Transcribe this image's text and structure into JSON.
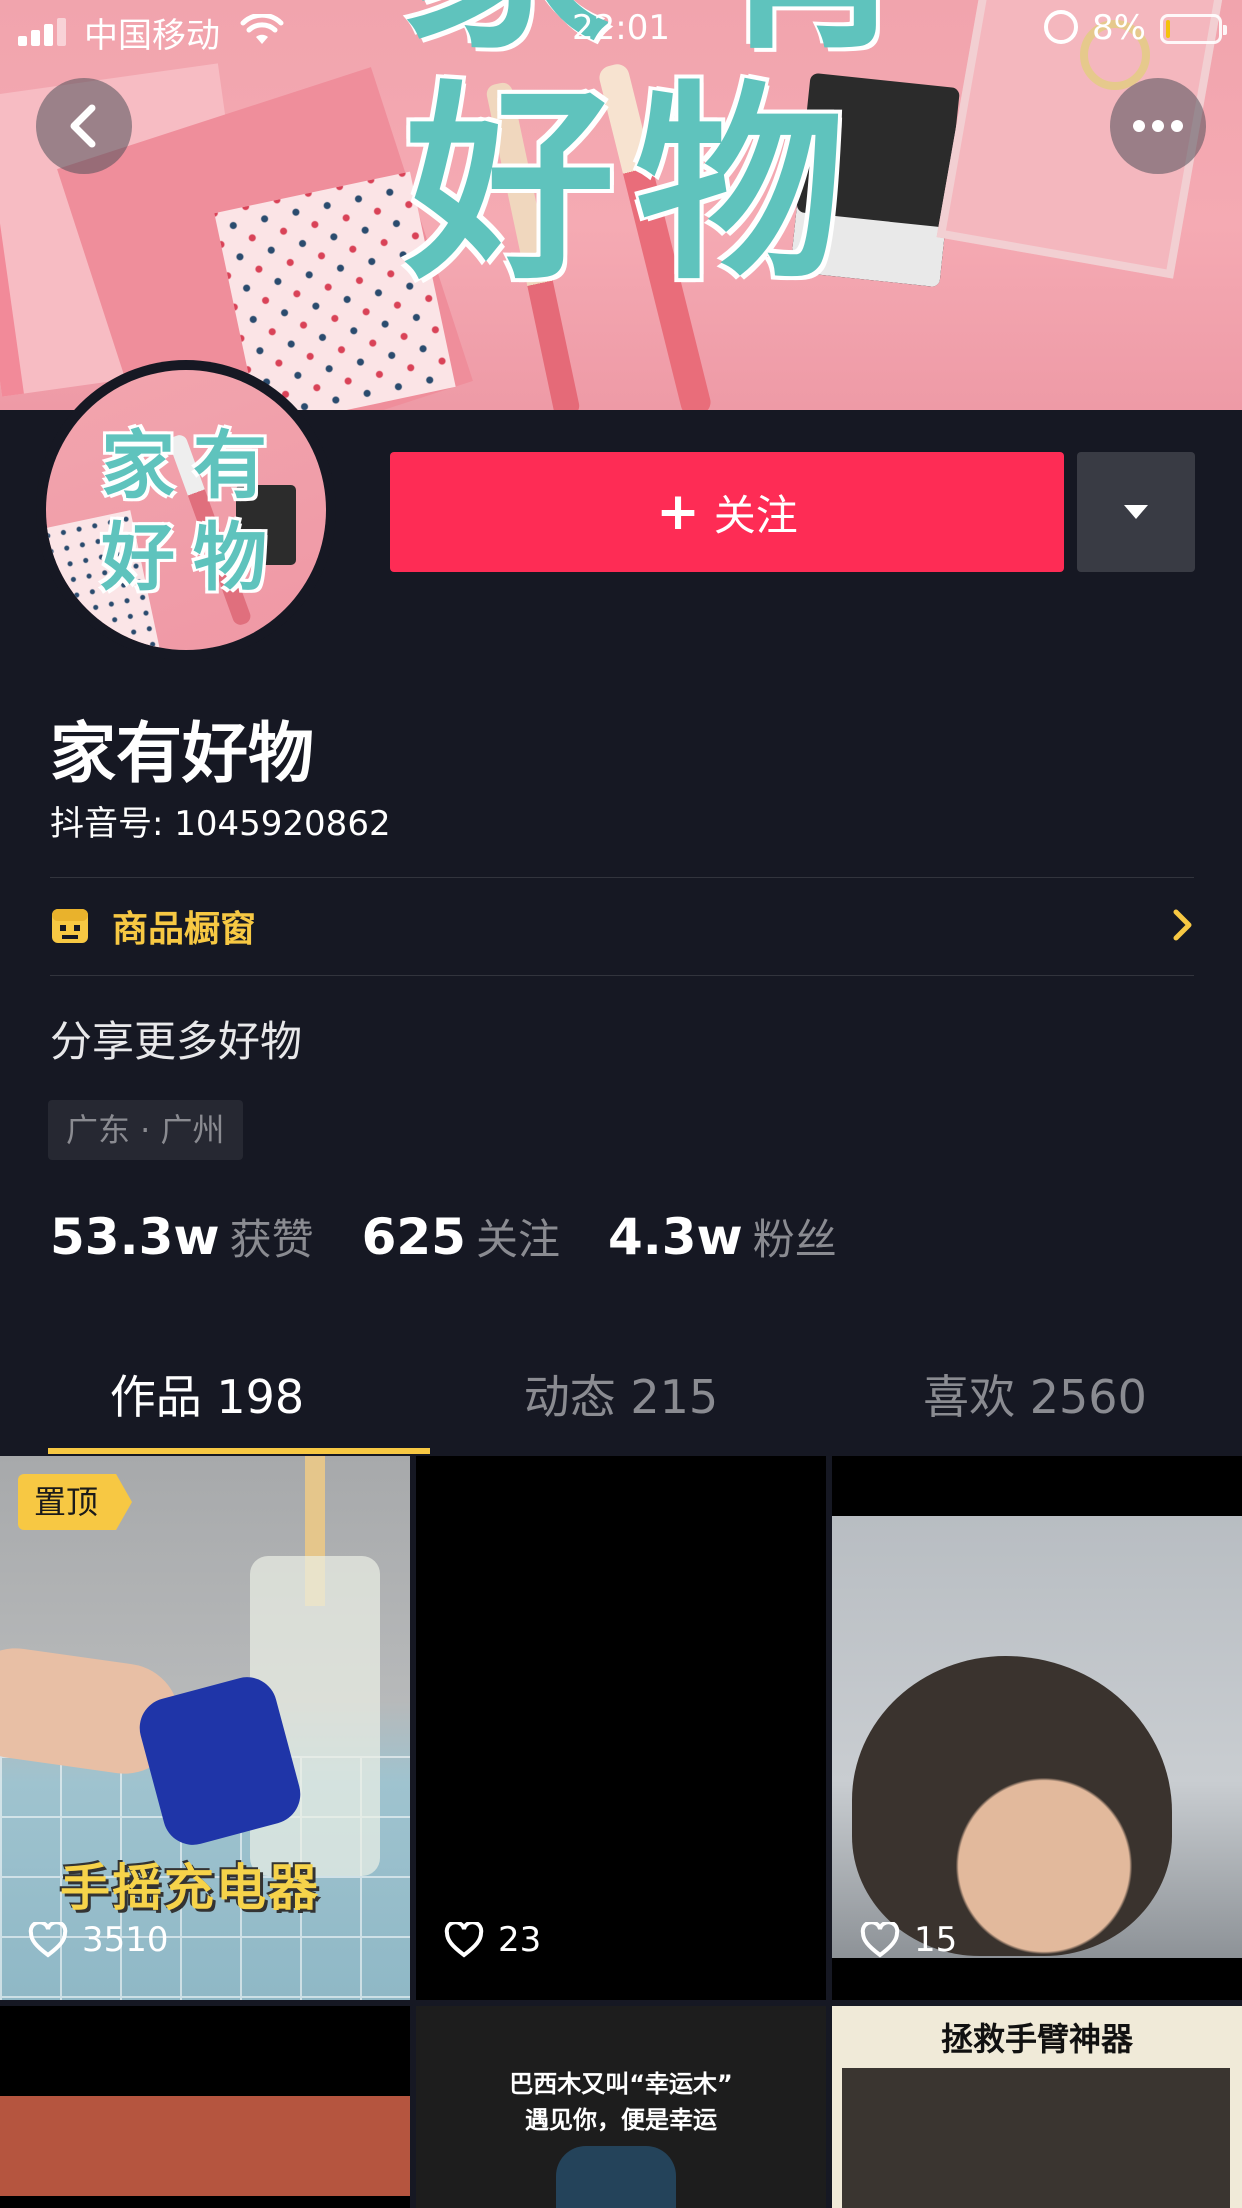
{
  "status_bar": {
    "carrier": "中国移动",
    "time": "22:01",
    "battery_percent": "8%",
    "battery_level": 0.08,
    "signal_icon": "signal-bars-icon",
    "wifi_icon": "wifi-icon",
    "lock_icon": "rotation-lock-icon"
  },
  "cover": {
    "title": "家有好物"
  },
  "profile": {
    "avatar_text": "家有好物",
    "nickname": "家有好物",
    "douyin_id": "抖音号: 1045920862",
    "follow_label": "关注",
    "shop_label": "商品橱窗",
    "bio": "分享更多好物",
    "location": "广东 · 广州"
  },
  "stats": [
    {
      "num": "53.3w",
      "label": "获赞"
    },
    {
      "num": "625",
      "label": "关注"
    },
    {
      "num": "4.3w",
      "label": "粉丝"
    }
  ],
  "tabs": [
    {
      "label": "作品 198",
      "active": true
    },
    {
      "label": "动态 215",
      "active": false
    },
    {
      "label": "喜欢 2560",
      "active": false
    }
  ],
  "videos": [
    {
      "likes": "3510",
      "pinned_label": "置顶",
      "caption": "手摇充电器"
    },
    {
      "likes": "23"
    },
    {
      "likes": "15"
    },
    {},
    {
      "caption_line1": "巴西木又叫“幸运木”",
      "caption_line2": "遇见你，便是幸运"
    },
    {
      "caption": "拯救手臂神器"
    }
  ],
  "colors": {
    "background": "#161823",
    "follow_button": "#fe2c55",
    "accent_yellow": "#f7c843",
    "muted_text": "#8a8b91"
  }
}
